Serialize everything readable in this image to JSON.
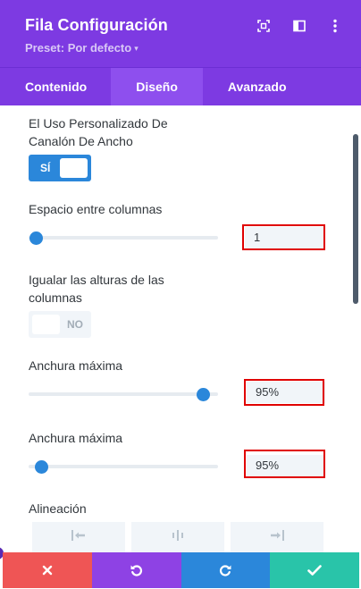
{
  "header": {
    "title": "Fila Configuración",
    "preset_label": "Preset: Por defecto",
    "icons": [
      "expand-icon",
      "sidebar-toggle-icon",
      "more-options-icon"
    ]
  },
  "tabs": [
    {
      "label": "Contenido",
      "active": false
    },
    {
      "label": "Diseño",
      "active": true
    },
    {
      "label": "Avanzado",
      "active": false
    }
  ],
  "settings": {
    "custom_gutter": {
      "label": "El Uso Personalizado De Canalón De Ancho",
      "toggle_label": "SÍ",
      "enabled": true
    },
    "column_spacing": {
      "label": "Espacio entre columnas",
      "value": "1",
      "slider_fraction": 0.04
    },
    "equal_heights": {
      "label": "Igualar las alturas de las columnas",
      "toggle_label": "NO",
      "enabled": false
    },
    "max_width_1": {
      "label": "Anchura máxima",
      "value": "95%",
      "slider_fraction": 0.92
    },
    "max_width_2": {
      "label": "Anchura máxima",
      "value": "95%",
      "slider_fraction": 0.07
    },
    "alignment": {
      "label": "Alineación",
      "options": [
        "align-left-icon",
        "align-center-icon",
        "align-right-icon"
      ]
    }
  },
  "footer": {
    "buttons": [
      "discard-icon",
      "undo-icon",
      "redo-icon",
      "save-check-icon"
    ]
  },
  "colors": {
    "header_bg": "#7d3ae2",
    "active_tab_bg": "#8e4fee",
    "accent_blue": "#2b87da",
    "discard_red": "#ef5555",
    "undo_purple": "#8e42e4",
    "save_green": "#29c4a9",
    "highlight_red": "#e00000"
  }
}
